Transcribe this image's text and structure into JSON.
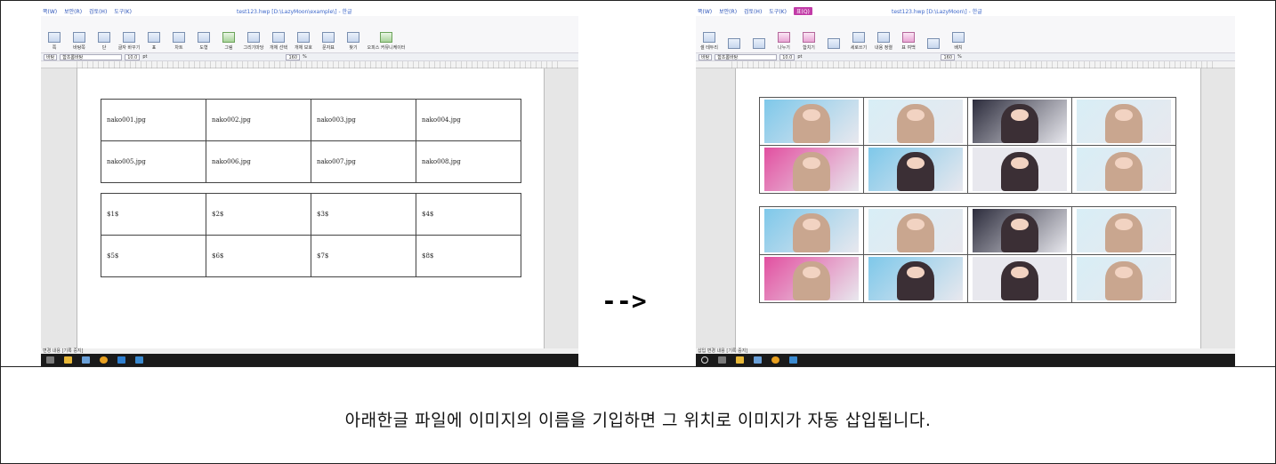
{
  "caption": "아래한글 파일에 이미지의 이름을 기입하면 그 위치로 이미지가 자동 삽입됩니다.",
  "arrow": "-->",
  "left_window": {
    "title": "test123.hwp [D:\\LazyMoon\\example\\] - 한글",
    "menus": [
      "쪽(W)",
      "보안(R)",
      "검토(H)",
      "도구(K)"
    ],
    "ribbon": [
      "쪽",
      "바탕쪽",
      "단",
      "글자 바꾸기",
      "표",
      "차트",
      "도형",
      "그림",
      "그리기마당",
      "개체 선택",
      "개체 보호",
      "문자표",
      "찾기",
      "오피스 커뮤니케이터"
    ],
    "format": {
      "style": "바탕",
      "font": "함초롬바탕",
      "size": "10.0",
      "unit": "pt",
      "zoom": "160",
      "zoom_unit": "%"
    },
    "status": "변경 내용 [기록 중지]",
    "table1": [
      [
        "nako001.jpg",
        "nako002.jpg",
        "nako003.jpg",
        "nako004.jpg"
      ],
      [
        "nako005.jpg",
        "nako006.jpg",
        "nako007.jpg",
        "nako008.jpg"
      ]
    ],
    "table2": [
      [
        "$1$",
        "$2$",
        "$3$",
        "$4$"
      ],
      [
        "$5$",
        "$6$",
        "$7$",
        "$8$"
      ]
    ]
  },
  "right_window": {
    "title": "test123.hwp [D:\\LazyMoon\\] - 한글",
    "menus": [
      "쪽(W)",
      "보안(R)",
      "검토(H)",
      "도구(K)",
      "표(Q)"
    ],
    "ribbon": [
      "셀 테두리",
      "나누기",
      "합치기",
      "세로쓰기",
      "내용 정렬",
      "표 여백",
      "배치"
    ],
    "format": {
      "style": "바탕",
      "font": "함초롬바탕",
      "size": "10.0",
      "unit": "pt",
      "zoom": "160",
      "zoom_unit": "%"
    },
    "status": "삽입 변경 내용 [기록 중지]"
  },
  "colors": {
    "border": "#222222",
    "photo_palette": [
      "#7ec8ea",
      "#c9a68f",
      "#2c2c3c",
      "#d8eef6",
      "#e24fa0",
      "#f0c8b0",
      "#3b2f35",
      "#e8e8ee"
    ]
  }
}
